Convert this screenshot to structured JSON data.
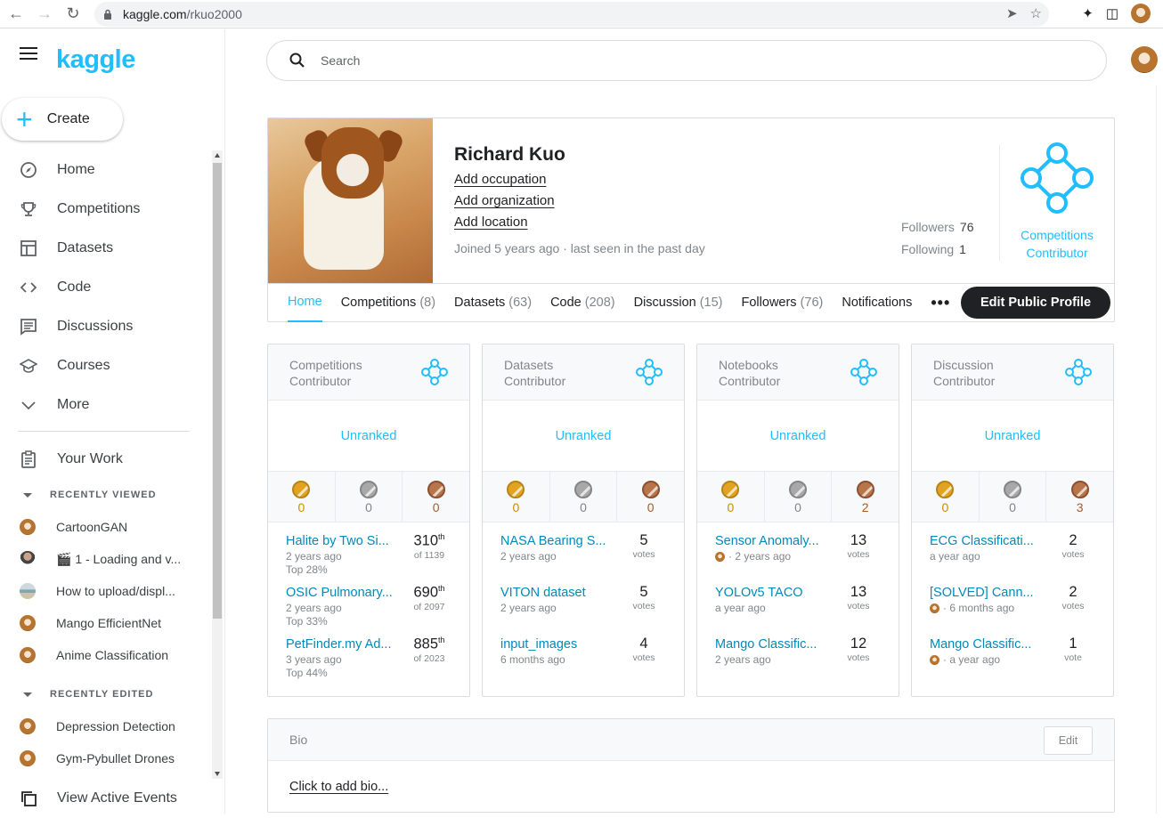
{
  "browser": {
    "url_host": "kaggle.com",
    "url_path": "/rkuo2000"
  },
  "sidebar": {
    "logo": "kaggle",
    "create_label": "Create",
    "nav": [
      {
        "label": "Home",
        "icon": "compass-icon"
      },
      {
        "label": "Competitions",
        "icon": "trophy-icon"
      },
      {
        "label": "Datasets",
        "icon": "table-icon"
      },
      {
        "label": "Code",
        "icon": "code-icon"
      },
      {
        "label": "Discussions",
        "icon": "comment-icon"
      },
      {
        "label": "Courses",
        "icon": "school-icon"
      },
      {
        "label": "More",
        "icon": "chevron-down-icon"
      }
    ],
    "your_work": "Your Work",
    "recently_viewed_label": "RECENTLY VIEWED",
    "recently_viewed": [
      {
        "label": "CartoonGAN",
        "thumb": "dog"
      },
      {
        "label": "🎬 1 - Loading and v...",
        "thumb": "man"
      },
      {
        "label": "How to upload/displ...",
        "thumb": "globe"
      },
      {
        "label": "Mango EfficientNet",
        "thumb": "dog"
      },
      {
        "label": "Anime Classification",
        "thumb": "dog"
      }
    ],
    "recently_edited_label": "RECENTLY EDITED",
    "recently_edited": [
      {
        "label": "Depression Detection",
        "thumb": "dog"
      },
      {
        "label": "Gym-Pybullet Drones",
        "thumb": "dog"
      }
    ],
    "active_events": "View Active Events"
  },
  "search": {
    "placeholder": "Search"
  },
  "profile": {
    "name": "Richard Kuo",
    "add_occupation": "Add occupation",
    "add_organization": "Add organization",
    "add_location": "Add location",
    "joined": "Joined 5 years ago · last seen in the past day",
    "followers_label": "Followers",
    "followers_count": "76",
    "following_label": "Following",
    "following_count": "1",
    "tier_label": "Competitions Contributor",
    "accent_color": "#20beff"
  },
  "tabs": [
    {
      "label": "Home",
      "count": ""
    },
    {
      "label": "Competitions",
      "count": "(8)"
    },
    {
      "label": "Datasets",
      "count": "(63)"
    },
    {
      "label": "Code",
      "count": "(208)"
    },
    {
      "label": "Discussion",
      "count": "(15)"
    },
    {
      "label": "Followers",
      "count": "(76)"
    },
    {
      "label": "Notifications",
      "count": ""
    }
  ],
  "edit_profile_label": "Edit Public Profile",
  "tier_cards": [
    {
      "title_line1": "Competitions",
      "title_line2": "Contributor",
      "rank": "Unranked",
      "gold": "0",
      "silver": "0",
      "bronze": "0",
      "items": [
        {
          "title": "Halite by Two Si...",
          "sub": "2 years ago",
          "sub2": "Top 28%",
          "big": "310",
          "sup": "th",
          "small": "of 1139"
        },
        {
          "title": "OSIC Pulmonary...",
          "sub": "2 years ago",
          "sub2": "Top 33%",
          "big": "690",
          "sup": "th",
          "small": "of 2097"
        },
        {
          "title": "PetFinder.my Ad...",
          "sub": "3 years ago",
          "sub2": "Top 44%",
          "big": "885",
          "sup": "th",
          "small": "of 2023"
        }
      ]
    },
    {
      "title_line1": "Datasets",
      "title_line2": "Contributor",
      "rank": "Unranked",
      "gold": "0",
      "silver": "0",
      "bronze": "0",
      "items": [
        {
          "title": "NASA Bearing S...",
          "sub": "2 years ago",
          "big": "5",
          "small": "votes"
        },
        {
          "title": "VITON dataset",
          "sub": "2 years ago",
          "big": "5",
          "small": "votes"
        },
        {
          "title": "input_images",
          "sub": "6 months ago",
          "big": "4",
          "small": "votes"
        }
      ]
    },
    {
      "title_line1": "Notebooks",
      "title_line2": "Contributor",
      "rank": "Unranked",
      "gold": "0",
      "silver": "0",
      "bronze": "2",
      "items": [
        {
          "title": "Sensor Anomaly...",
          "sub": "· 2 years ago",
          "avatar": true,
          "big": "13",
          "small": "votes"
        },
        {
          "title": "YOLOv5 TACO",
          "sub": "a year ago",
          "big": "13",
          "small": "votes"
        },
        {
          "title": "Mango Classific...",
          "sub": "2 years ago",
          "big": "12",
          "small": "votes"
        }
      ]
    },
    {
      "title_line1": "Discussion",
      "title_line2": "Contributor",
      "rank": "Unranked",
      "gold": "0",
      "silver": "0",
      "bronze": "3",
      "items": [
        {
          "title": "ECG Classificati...",
          "sub": "a year ago",
          "big": "2",
          "small": "votes"
        },
        {
          "title": "[SOLVED] Cann...",
          "sub": "· 6 months ago",
          "avatar": true,
          "big": "2",
          "small": "votes"
        },
        {
          "title": "Mango Classific...",
          "sub": "· a year ago",
          "avatar": true,
          "big": "1",
          "small": "vote"
        }
      ]
    }
  ],
  "bio": {
    "title": "Bio",
    "edit_label": "Edit",
    "add_label": "Click to add bio..."
  }
}
